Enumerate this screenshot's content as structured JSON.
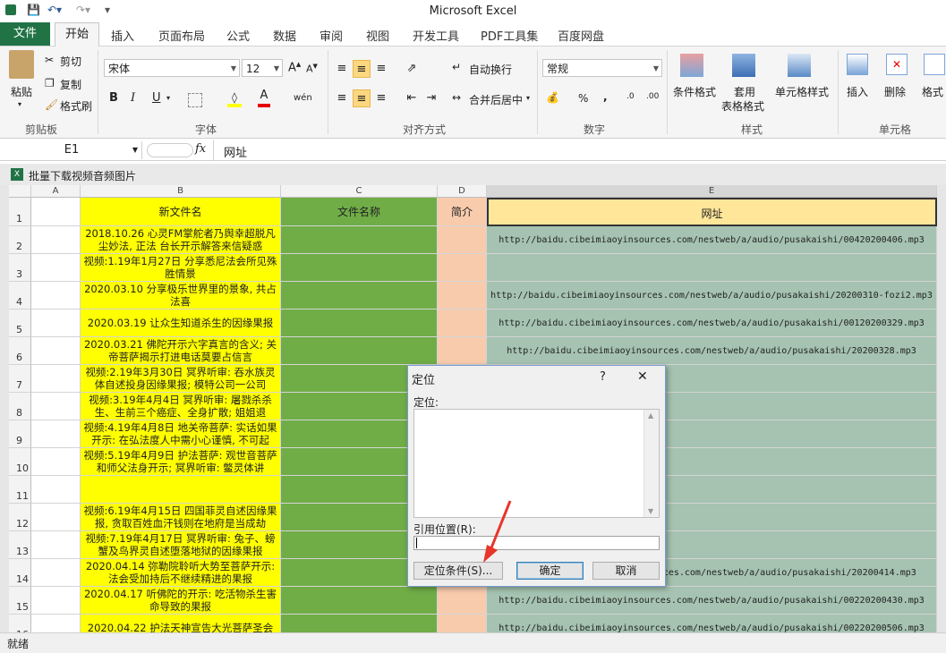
{
  "app_title": "Microsoft Excel",
  "tabs": [
    "文件",
    "开始",
    "插入",
    "页面布局",
    "公式",
    "数据",
    "审阅",
    "视图",
    "开发工具",
    "PDF工具集",
    "百度网盘"
  ],
  "ribbon": {
    "clipboard": {
      "paste": "粘贴",
      "cut": "剪切",
      "copy": "复制",
      "format_painter": "格式刷",
      "group": "剪贴板"
    },
    "font": {
      "font_name": "宋体",
      "font_size": "12",
      "bold": "B",
      "italic": "I",
      "underline": "U",
      "phonetic": "wén",
      "group": "字体"
    },
    "alignment": {
      "wrap": "自动换行",
      "merge": "合并后居中",
      "group": "对齐方式"
    },
    "number": {
      "format": "常规",
      "percent": "%",
      "comma": ",",
      "group": "数字"
    },
    "styles": {
      "conditional": "条件格式",
      "table_format_1": "套用",
      "table_format_2": "表格格式",
      "cell_styles": "单元格样式",
      "group": "样式"
    },
    "cells": {
      "insert": "插入",
      "delete": "删除",
      "format": "格式",
      "group": "单元格"
    }
  },
  "formula_bar": {
    "name_box": "E1",
    "fx": "fx",
    "content": "网址"
  },
  "workbook_title": "批量下载视频音频图片",
  "columns": [
    "A",
    "B",
    "C",
    "D",
    "E"
  ],
  "rows": [
    {
      "num": "1",
      "b": "新文件名",
      "c": "文件名称",
      "d": "简介",
      "e": "网址"
    },
    {
      "num": "2",
      "b": "2018.10.26 心灵FM掌舵者乃舆幸超脱凡尘妙法, 正法 台长开示解答来信疑惑",
      "c": "",
      "d": "",
      "e": "http://baidu.cibeimiaoyinsources.com/nestweb/a/audio/pusakaishi/00420200406.mp3"
    },
    {
      "num": "3",
      "b": "视频:1.19年1月27日 分享悉尼法会所见殊胜情景",
      "c": "",
      "d": "",
      "e": ""
    },
    {
      "num": "4",
      "b": "2020.03.10 分享极乐世界里的景象, 共占法喜",
      "c": "",
      "d": "",
      "e": "http://baidu.cibeimiaoyinsources.com/nestweb/a/audio/pusakaishi/20200310-fozi2.mp3"
    },
    {
      "num": "5",
      "b": "2020.03.19 让众生知道杀生的因缘果报",
      "c": "",
      "d": "",
      "e": "http://baidu.cibeimiaoyinsources.com/nestweb/a/audio/pusakaishi/00120200329.mp3"
    },
    {
      "num": "6",
      "b": "2020.03.21 佛陀开示六字真言的含义; 关帝菩萨揭示打进电话莫要占信言",
      "c": "",
      "d": "",
      "e": "http://baidu.cibeimiaoyinsources.com/nestweb/a/audio/pusakaishi/20200328.mp3"
    },
    {
      "num": "7",
      "b": "视频:2.19年3月30日 冥界听审: 吞水族灵体自述投身因缘果报; 模特公司一公司",
      "c": "",
      "d": "",
      "e": ""
    },
    {
      "num": "8",
      "b": "视频:3.19年4月4日 冥界听审: 屠戮杀杀生、生前三个癌症、全身扩散; 姐姐退",
      "c": "",
      "d": "",
      "e": ""
    },
    {
      "num": "9",
      "b": "视频:4.19年4月8日 地关帝菩萨: 实话如果开示: 在弘法度人中需小心谨慎, 不可起",
      "c": "",
      "d": "",
      "e": ""
    },
    {
      "num": "10",
      "b": "视频:5.19年4月9日 护法菩萨: 观世音菩萨和师父法身开示; 冥界听审: 鳖灵体讲",
      "c": "",
      "d": "",
      "e": ""
    },
    {
      "num": "11",
      "b": "",
      "c": "",
      "d": "",
      "e": ""
    },
    {
      "num": "12",
      "b": "视频:6.19年4月15日 四国菲灵自述因缘果报, 贪取百姓血汗钱则在地府是当成劫",
      "c": "",
      "d": "",
      "e": ""
    },
    {
      "num": "13",
      "b": "视频:7.19年4月17日 冥界听审: 兔子、螃蟹及鸟界灵自述堕落地狱的因缘果报",
      "c": "",
      "d": "",
      "e": ""
    },
    {
      "num": "14",
      "b": "2020.04.14 弥勒院聆听大势至菩萨开示: 法会受加持后不继续精进的果报",
      "c": "",
      "d": "",
      "e": "http://baidu.cibeimiaoyinsources.com/nestweb/a/audio/pusakaishi/20200414.mp3"
    },
    {
      "num": "15",
      "b": "2020.04.17 听佛陀的开示: 吃活物杀生害命导致的果报",
      "c": "",
      "d": "",
      "e": "http://baidu.cibeimiaoyinsources.com/nestweb/a/audio/pusakaishi/00220200430.mp3"
    },
    {
      "num": "16",
      "b": "2020.04.22 护法天神宣告大光菩萨圣会",
      "c": "",
      "d": "",
      "e": "http://baidu.cibeimiaoyinsources.com/nestweb/a/audio/pusakaishi/00220200506.mp3"
    }
  ],
  "dialog": {
    "title": "定位",
    "help": "?",
    "close": "✕",
    "list_label": "定位:",
    "ref_label": "引用位置(R):",
    "ref_value": "",
    "special": "定位条件(S)...",
    "ok": "确定",
    "cancel": "取消"
  },
  "status": "就绪",
  "colors": {
    "excel_green": "#217346",
    "yellow": "#ffff00",
    "green_col": "#70ad47",
    "peach": "#f8cbad",
    "teal": "#a5c3b0",
    "header_gold": "#ffe699",
    "arrow": "#e8342a"
  }
}
